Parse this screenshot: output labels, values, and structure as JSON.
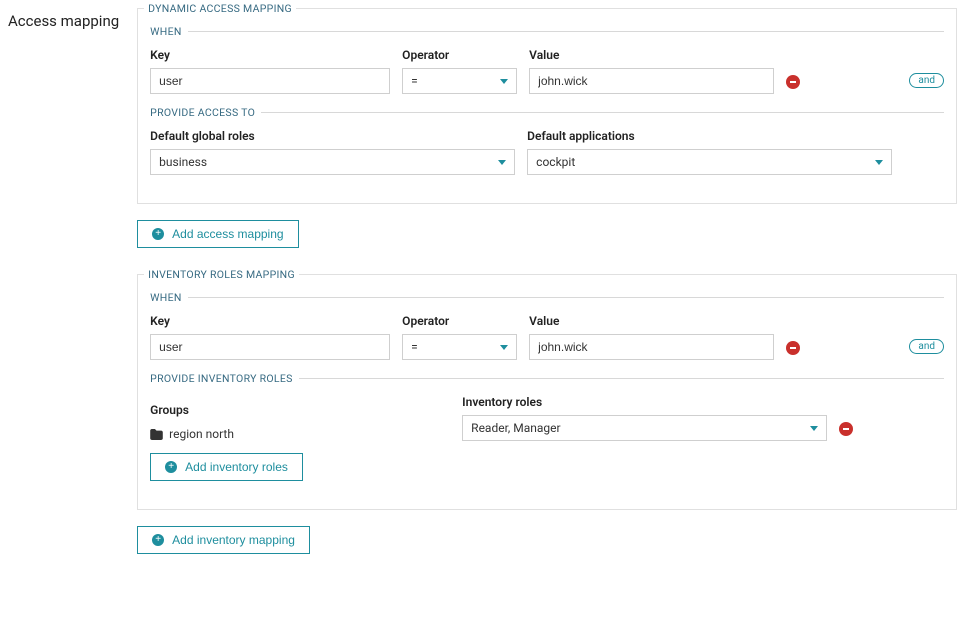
{
  "page": {
    "title": "Access mapping"
  },
  "dynamic": {
    "section_label": "DYNAMIC ACCESS MAPPING",
    "when": {
      "label": "WHEN",
      "key_label": "Key",
      "op_label": "Operator",
      "val_label": "Value",
      "key": "user",
      "operator": "=",
      "value": "john.wick",
      "and_label": "and"
    },
    "provide": {
      "label": "PROVIDE ACCESS TO",
      "roles_label": "Default global roles",
      "apps_label": "Default applications",
      "roles_value": "business",
      "apps_value": "cockpit"
    },
    "add_label": "Add access mapping"
  },
  "inventory": {
    "section_label": "INVENTORY ROLES MAPPING",
    "when": {
      "label": "WHEN",
      "key_label": "Key",
      "op_label": "Operator",
      "val_label": "Value",
      "key": "user",
      "operator": "=",
      "value": "john.wick",
      "and_label": "and"
    },
    "provide": {
      "label": "PROVIDE INVENTORY ROLES",
      "groups_label": "Groups",
      "group_item": "region north",
      "roles_label": "Inventory roles",
      "roles_value": "Reader, Manager"
    },
    "add_roles_label": "Add inventory roles",
    "add_mapping_label": "Add inventory mapping"
  }
}
